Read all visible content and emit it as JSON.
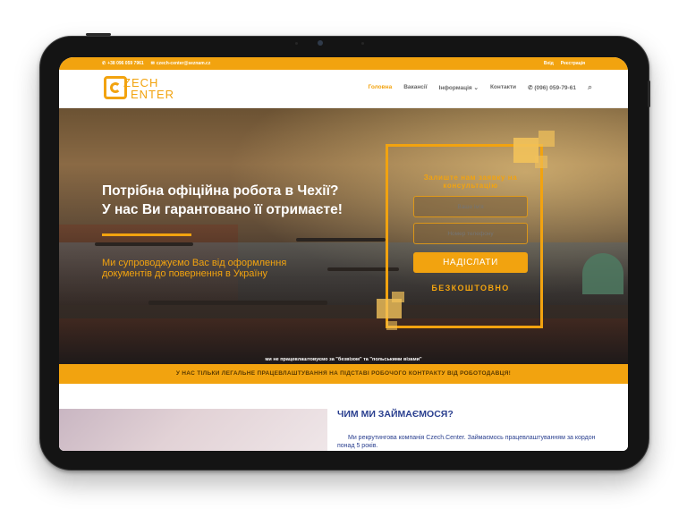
{
  "topbar": {
    "phone": "+38 096 059 7961",
    "email": "czech-center@seznam.cz",
    "login": "Вхід",
    "register": "Реєстрація"
  },
  "logo": {
    "text_line1": "ZECH",
    "text_line2": "ENTER"
  },
  "nav": {
    "items": [
      {
        "label": "Головна",
        "active": true
      },
      {
        "label": "Вакансії",
        "active": false
      },
      {
        "label": "Інформація",
        "active": false,
        "has_dropdown": true
      },
      {
        "label": "Контакти",
        "active": false
      }
    ],
    "phone": "(096) 059-79-61",
    "search_icon": "search-icon",
    "dropdown_icon": "chevron-down-icon"
  },
  "hero": {
    "title_line1": "Потрібна офіційна робота в Чехії?",
    "title_line2": "У нас Ви гарантовано її отримаєте!",
    "subtitle_line1": "Ми супроводжуємо Вас від оформлення",
    "subtitle_line2": "документів до повернення в Україну",
    "note": "ми не працевлаштовуємо за \"безвізом\" та \"польськими візами\""
  },
  "form": {
    "title_line1": "Залиште нам заявку на",
    "title_line2": "консультацію",
    "name_placeholder": "Ваше ім'я",
    "phone_placeholder": "Номер телефону",
    "submit_label": "НАДІСЛАТИ",
    "free_label": "БЕЗКОШТОВНО"
  },
  "band": {
    "text": "У НАС ТІЛЬКИ ЛЕГАЛЬНЕ ПРАЦЕВЛАШТУВАННЯ НА ПІДСТАВІ РОБОЧОГО КОНТРАКТУ ВІД РОБОТОДАВЦЯ!"
  },
  "about": {
    "heading": "ЧИМ МИ ЗАЙМАЄМОСЯ?",
    "para_line1": "Ми рекрутингова компанія Czech.Center. Займаємось працевлаштуванням за кордон",
    "para_line2": "понад 5 років."
  },
  "colors": {
    "accent": "#f2a30f",
    "heading": "#2a3f8f"
  }
}
